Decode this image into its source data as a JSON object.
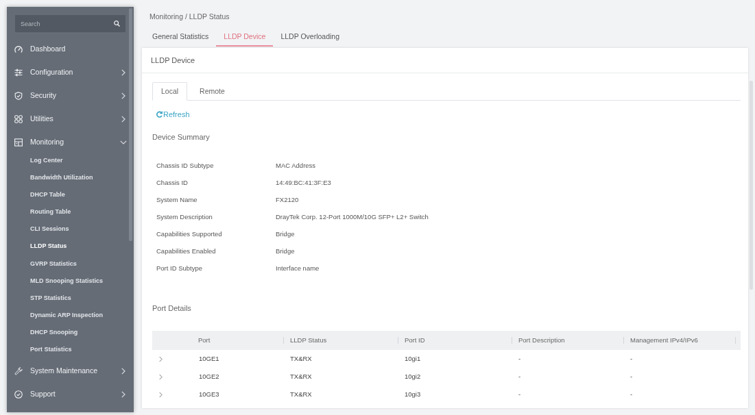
{
  "sidebar": {
    "search": {
      "placeholder": "Search"
    },
    "items": [
      {
        "kind": "link",
        "label": "Dashboard"
      },
      {
        "kind": "group",
        "label": "Configuration",
        "expanded": false
      },
      {
        "kind": "group",
        "label": "Security",
        "expanded": false
      },
      {
        "kind": "group",
        "label": "Utilities",
        "expanded": false
      },
      {
        "kind": "group",
        "label": "Monitoring",
        "expanded": true,
        "children": [
          {
            "label": "Log Center",
            "selected": false
          },
          {
            "label": "Bandwidth Utilization",
            "selected": false
          },
          {
            "label": "DHCP Table",
            "selected": false
          },
          {
            "label": "Routing Table",
            "selected": false
          },
          {
            "label": "CLI Sessions",
            "selected": false
          },
          {
            "label": "LLDP Status",
            "selected": true
          },
          {
            "label": "GVRP Statistics",
            "selected": false
          },
          {
            "label": "MLD Snooping Statistics",
            "selected": false
          },
          {
            "label": "STP Statistics",
            "selected": false
          },
          {
            "label": "Dynamic ARP Inspection",
            "selected": false
          },
          {
            "label": "DHCP Snooping",
            "selected": false
          },
          {
            "label": "Port Statistics",
            "selected": false
          }
        ]
      },
      {
        "kind": "group",
        "label": "System Maintenance",
        "expanded": false
      },
      {
        "kind": "group",
        "label": "Support",
        "expanded": false
      }
    ]
  },
  "breadcrumb": "Monitoring / LLDP Status",
  "tabs": [
    {
      "label": "General Statistics",
      "selected": false
    },
    {
      "label": "LLDP Device",
      "selected": true
    },
    {
      "label": "LLDP Overloading",
      "selected": false
    }
  ],
  "panel": {
    "title": "LLDP Device",
    "tabs": [
      {
        "label": "Local",
        "selected": true
      },
      {
        "label": "Remote",
        "selected": false
      }
    ],
    "refresh": "Refresh",
    "device_summary": {
      "title": "Device Summary",
      "rows": [
        {
          "label": "Chassis ID Subtype",
          "value": "MAC Address"
        },
        {
          "label": "Chassis ID",
          "value": "14:49:BC:41:3F:E3"
        },
        {
          "label": "System Name",
          "value": "FX2120"
        },
        {
          "label": "System Description",
          "value": "DrayTek Corp. 12-Port 1000M/10G SFP+ L2+ Switch"
        },
        {
          "label": "Capabilities Supported",
          "value": "Bridge"
        },
        {
          "label": "Capabilities Enabled",
          "value": "Bridge"
        },
        {
          "label": "Port ID Subtype",
          "value": "Interface name"
        }
      ]
    },
    "port_details": {
      "title": "Port Details",
      "columns": [
        "Port",
        "LLDP Status",
        "Port ID",
        "Port Description",
        "Management IPv4/IPv6"
      ],
      "rows": [
        {
          "expanded": false,
          "cells": [
            "10GE1",
            "TX&RX",
            "10gi1",
            "-",
            "-"
          ]
        },
        {
          "expanded": false,
          "cells": [
            "10GE2",
            "TX&RX",
            "10gi2",
            "-",
            "-"
          ]
        },
        {
          "expanded": false,
          "cells": [
            "10GE3",
            "TX&RX",
            "10gi3",
            "-",
            "-"
          ]
        }
      ]
    }
  }
}
